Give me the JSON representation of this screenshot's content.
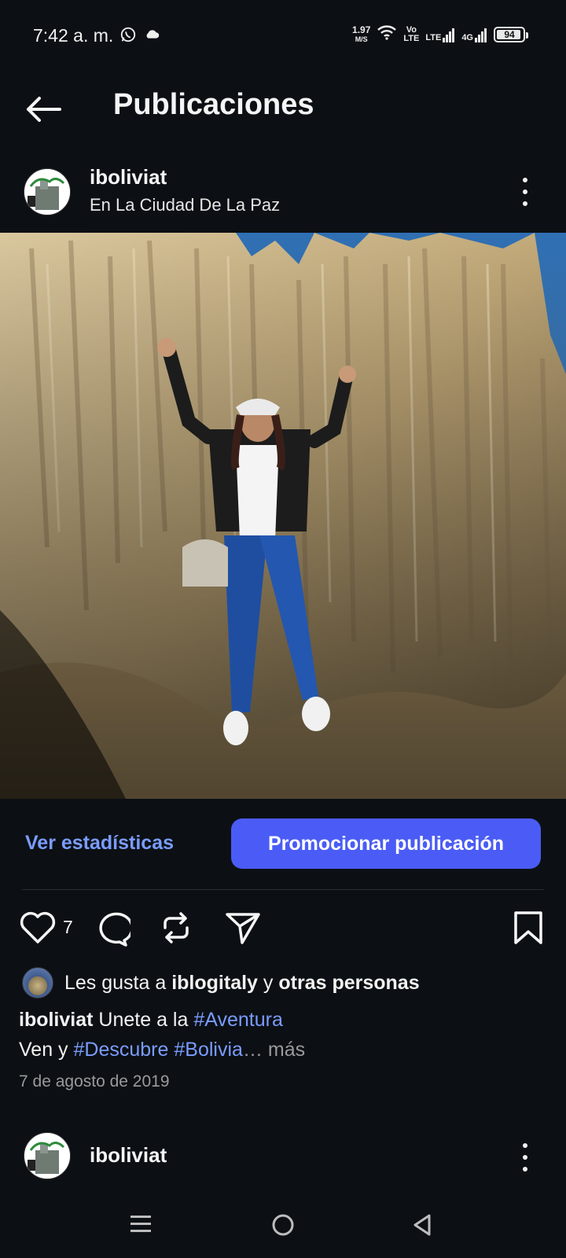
{
  "status_bar": {
    "time": "7:42 a. m.",
    "speed_value": "1.97",
    "speed_unit": "M/S",
    "volte_top": "Vo",
    "volte_bottom": "LTE",
    "lte": "LTE",
    "net_4g": "4G",
    "battery": "94",
    "battery_level": 0.94
  },
  "header": {
    "title": "Publicaciones"
  },
  "post": {
    "username": "iboliviat",
    "location": "En La Ciudad De La Paz",
    "stats_link": "Ver estadísticas",
    "promote_button": "Promocionar publicación",
    "like_count": "7",
    "likes": {
      "prefix": "Les gusta a",
      "user": "iblogitaly",
      "connector": "y",
      "others": "otras personas"
    },
    "caption": {
      "user": "iboliviat",
      "text1": "Unete a la",
      "tag1": "#Aventura",
      "text2": "Ven y",
      "tag2": "#Descubre",
      "tag3": "#Bolivia",
      "ellipsis": "…",
      "more": "más"
    },
    "date": "7 de agosto de 2019"
  },
  "next_post": {
    "username": "iboliviat"
  },
  "colors": {
    "background": "#0c1014",
    "accent": "#4a5cf5",
    "link": "#7a9cff"
  }
}
